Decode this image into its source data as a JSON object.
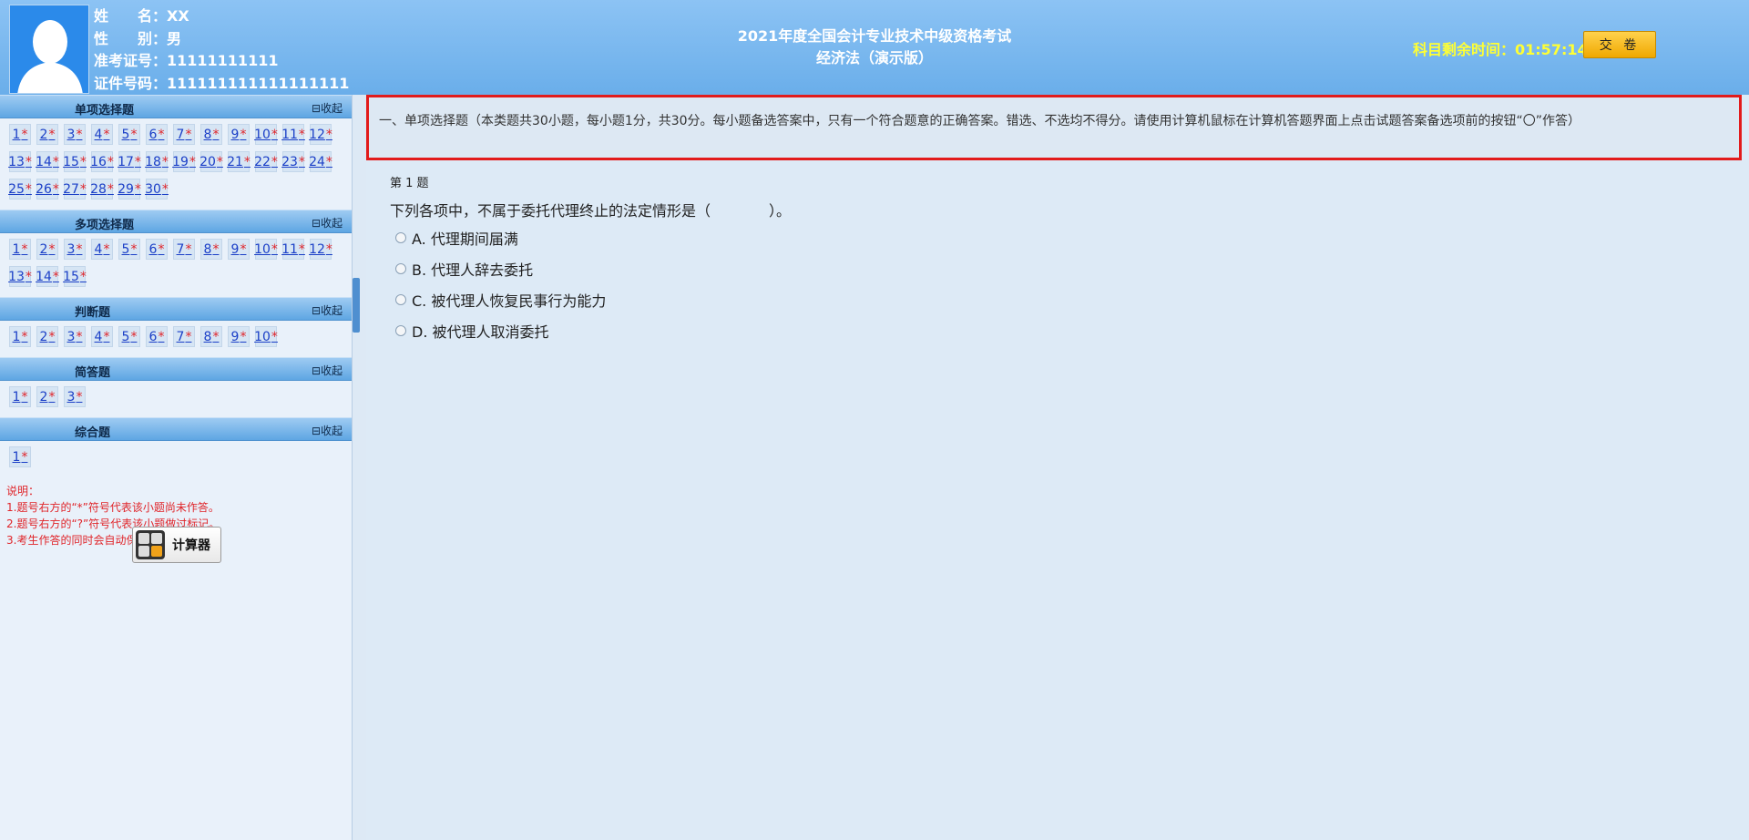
{
  "candidate": {
    "name_label": "姓　　名：",
    "name": "XX",
    "gender_label": "性　　别：",
    "gender": "男",
    "ticket_label": "准考证号：",
    "ticket": "11111111111",
    "id_label": "证件号码：",
    "id": "111111111111111111"
  },
  "exam": {
    "title": "2021年度全国会计专业技术中级资格考试",
    "subtitle": "经济法（演示版）"
  },
  "timer": {
    "label": "科目剩余时间：",
    "value": "01:57:14"
  },
  "submit_label": "交 卷",
  "collapse_label": "⊟收起",
  "sections": [
    {
      "title": "单项选择题",
      "count": 30
    },
    {
      "title": "多项选择题",
      "count": 15
    },
    {
      "title": "判断题",
      "count": 10
    },
    {
      "title": "简答题",
      "count": 3
    },
    {
      "title": "综合题",
      "count": 1
    }
  ],
  "unanswered_mark": "*",
  "notes": [
    "说明：",
    "1.题号右方的“*”符号代表该小题尚未作答。",
    "2.题号右方的“?”符号代表该小题做过标记。",
    "3.考生作答的同时会自动保存答案。"
  ],
  "calculator_label": "计算器",
  "instructions": "一、单项选择题（本类题共30小题，每小题1分，共30分。每小题备选答案中，只有一个符合题意的正确答案。错选、不选均不得分。请使用计算机鼠标在计算机答题界面上点击试题答案备选项前的按钮“〇”作答）",
  "question": {
    "number_label": "第 1 题",
    "stem": "下列各项中，不属于委托代理终止的法定情形是（　　　　）。",
    "options": [
      "A. 代理期间届满",
      "B. 代理人辞去委托",
      "C. 被代理人恢复民事行为能力",
      "D. 被代理人取消委托"
    ]
  }
}
